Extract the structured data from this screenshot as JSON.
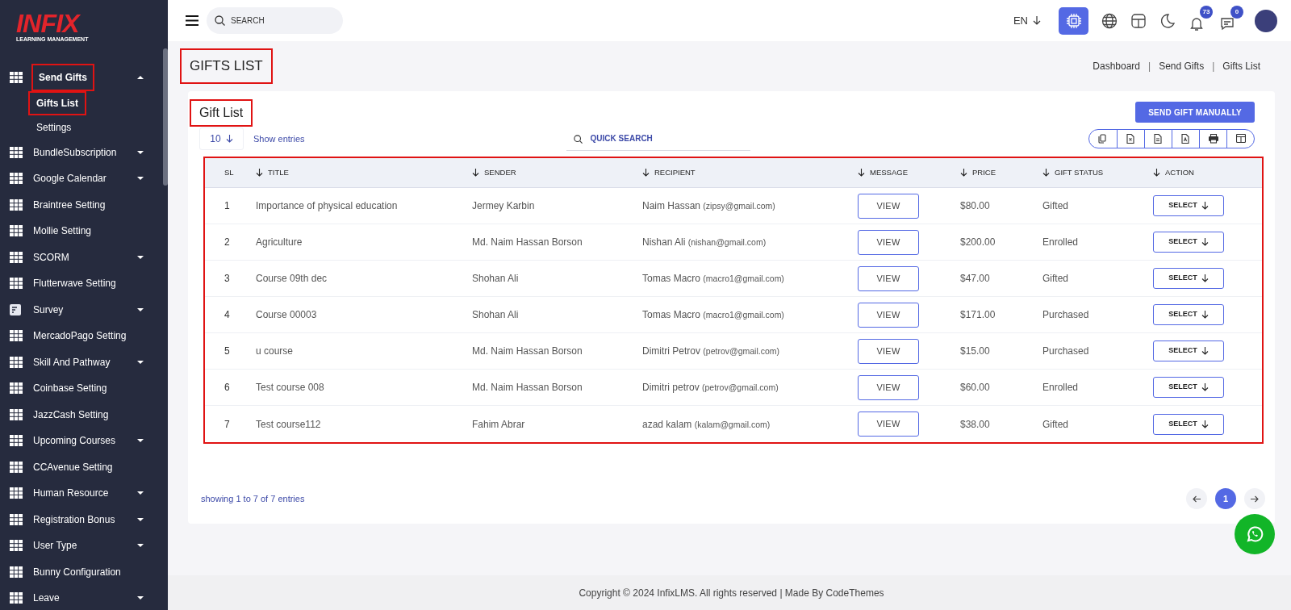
{
  "logo": {
    "brand": "INFIX",
    "tagline": "LEARNING MANAGEMENT"
  },
  "sidebar": {
    "items": [
      {
        "label": "Send Gifts",
        "has_submenu": true,
        "expanded": true,
        "annotated": true,
        "children": [
          {
            "label": "Gifts List",
            "selected": true,
            "annotated": true
          },
          {
            "label": "Settings",
            "selected": false,
            "annotated": false
          }
        ]
      },
      {
        "label": "BundleSubscription",
        "has_submenu": true,
        "expanded": false,
        "annotated": false
      },
      {
        "label": "Google Calendar",
        "has_submenu": true,
        "expanded": false,
        "annotated": false
      },
      {
        "label": "Braintree Setting",
        "has_submenu": false,
        "expanded": false,
        "annotated": false
      },
      {
        "label": "Mollie Setting",
        "has_submenu": false,
        "expanded": false,
        "annotated": false
      },
      {
        "label": "SCORM",
        "has_submenu": true,
        "expanded": false,
        "annotated": false
      },
      {
        "label": "Flutterwave Setting",
        "has_submenu": false,
        "expanded": false,
        "annotated": false
      },
      {
        "label": "Survey",
        "kind": "survey",
        "has_submenu": true,
        "expanded": false,
        "annotated": false
      },
      {
        "label": "MercadoPago Setting",
        "has_submenu": false,
        "expanded": false,
        "annotated": false
      },
      {
        "label": "Skill And Pathway",
        "has_submenu": true,
        "expanded": false,
        "annotated": false
      },
      {
        "label": "Coinbase Setting",
        "has_submenu": false,
        "expanded": false,
        "annotated": false
      },
      {
        "label": "JazzCash Setting",
        "has_submenu": false,
        "expanded": false,
        "annotated": false
      },
      {
        "label": "Upcoming Courses",
        "has_submenu": true,
        "expanded": false,
        "annotated": false
      },
      {
        "label": "CCAvenue Setting",
        "has_submenu": false,
        "expanded": false,
        "annotated": false
      },
      {
        "label": "Human Resource",
        "has_submenu": true,
        "expanded": false,
        "annotated": false
      },
      {
        "label": "Registration Bonus",
        "has_submenu": true,
        "expanded": false,
        "annotated": false
      },
      {
        "label": "User Type",
        "has_submenu": true,
        "expanded": false,
        "annotated": false
      },
      {
        "label": "Bunny Configuration",
        "has_submenu": false,
        "expanded": false,
        "annotated": false
      },
      {
        "label": "Leave",
        "has_submenu": true,
        "expanded": false,
        "annotated": false
      }
    ]
  },
  "header": {
    "search_placeholder": "SEARCH",
    "language": "EN",
    "notification_count": "73",
    "message_count": "0"
  },
  "page": {
    "title": "GIFTS LIST",
    "annotated": true,
    "breadcrumbs": [
      {
        "kind": "link",
        "label": "Dashboard"
      },
      {
        "kind": "separator",
        "label": "|"
      },
      {
        "kind": "link",
        "label": "Send Gifts"
      },
      {
        "kind": "separator",
        "label": "|"
      },
      {
        "kind": "link",
        "label": "Gifts List"
      }
    ]
  },
  "card": {
    "title": "Gift List",
    "annotated": true,
    "add_button": "SEND GIFT MANUALLY",
    "page_size": "10",
    "show_entries": "Show entries",
    "quick_search_placeholder": "QUICK SEARCH",
    "export_buttons": [
      {
        "kind": "copy"
      },
      {
        "kind": "excel"
      },
      {
        "kind": "csv"
      },
      {
        "kind": "pdf"
      },
      {
        "kind": "print"
      },
      {
        "kind": "columns"
      }
    ],
    "table": {
      "annotated": true,
      "columns": [
        {
          "label": "SL",
          "sortable": false
        },
        {
          "label": "TITLE",
          "sortable": true
        },
        {
          "label": "SENDER",
          "sortable": true
        },
        {
          "label": "RECIPIENT",
          "sortable": true
        },
        {
          "label": "MESSAGE",
          "sortable": true
        },
        {
          "label": "PRICE",
          "sortable": true
        },
        {
          "label": "GIFT STATUS",
          "sortable": true
        },
        {
          "label": "ACTION",
          "sortable": true
        }
      ],
      "rows": [
        {
          "sl": "1",
          "title": "Importance of physical education",
          "sender": "Jermey Karbin",
          "recipient_name": "Naim Hassan",
          "recipient_email": "(zipsy@gmail.com)",
          "message": "VIEW",
          "price": "$80.00",
          "status": "Gifted",
          "action": "SELECT"
        },
        {
          "sl": "2",
          "title": "Agriculture",
          "sender": "Md. Naim Hassan Borson",
          "recipient_name": "Nishan Ali",
          "recipient_email": "(nishan@gmail.com)",
          "message": "VIEW",
          "price": "$200.00",
          "status": "Enrolled",
          "action": "SELECT"
        },
        {
          "sl": "3",
          "title": "Course 09th dec",
          "sender": "Shohan Ali",
          "recipient_name": "Tomas Macro",
          "recipient_email": "(macro1@gmail.com)",
          "message": "VIEW",
          "price": "$47.00",
          "status": "Gifted",
          "action": "SELECT"
        },
        {
          "sl": "4",
          "title": "Course 00003",
          "sender": "Shohan Ali",
          "recipient_name": "Tomas Macro",
          "recipient_email": "(macro1@gmail.com)",
          "message": "VIEW",
          "price": "$171.00",
          "status": "Purchased",
          "action": "SELECT"
        },
        {
          "sl": "5",
          "title": "u course",
          "sender": "Md. Naim Hassan Borson",
          "recipient_name": "Dimitri Petrov",
          "recipient_email": "(petrov@gmail.com)",
          "message": "VIEW",
          "price": "$15.00",
          "status": "Purchased",
          "action": "SELECT"
        },
        {
          "sl": "6",
          "title": "Test course 008",
          "sender": "Md. Naim Hassan Borson",
          "recipient_name": "Dimitri petrov",
          "recipient_email": "(petrov@gmail.com)",
          "message": "VIEW",
          "price": "$60.00",
          "status": "Enrolled",
          "action": "SELECT"
        },
        {
          "sl": "7",
          "title": "Test course112",
          "sender": "Fahim Abrar",
          "recipient_name": "azad kalam",
          "recipient_email": "(kalam@gmail.com)",
          "message": "VIEW",
          "price": "$38.00",
          "status": "Gifted",
          "action": "SELECT"
        }
      ]
    },
    "entries_info": "showing 1 to 7 of 7 entries",
    "pages": [
      {
        "label": "1",
        "selected": true
      }
    ]
  },
  "footer": {
    "copyright": "Copyright © 2024 InfixLMS. All rights reserved | Made By CodeThemes"
  }
}
